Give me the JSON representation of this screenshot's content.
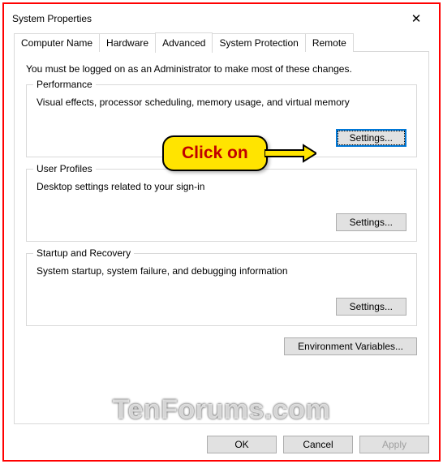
{
  "window": {
    "title": "System Properties"
  },
  "tabs": {
    "computer_name": "Computer Name",
    "hardware": "Hardware",
    "advanced": "Advanced",
    "system_protection": "System Protection",
    "remote": "Remote"
  },
  "intro": "You must be logged on as an Administrator to make most of these changes.",
  "groups": {
    "performance": {
      "label": "Performance",
      "desc": "Visual effects, processor scheduling, memory usage, and virtual memory",
      "button": "Settings..."
    },
    "user_profiles": {
      "label": "User Profiles",
      "desc": "Desktop settings related to your sign-in",
      "button": "Settings..."
    },
    "startup": {
      "label": "Startup and Recovery",
      "desc": "System startup, system failure, and debugging information",
      "button": "Settings..."
    }
  },
  "env_button": "Environment Variables...",
  "buttons": {
    "ok": "OK",
    "cancel": "Cancel",
    "apply": "Apply"
  },
  "callout": "Click on",
  "watermark": "TenForums.com"
}
